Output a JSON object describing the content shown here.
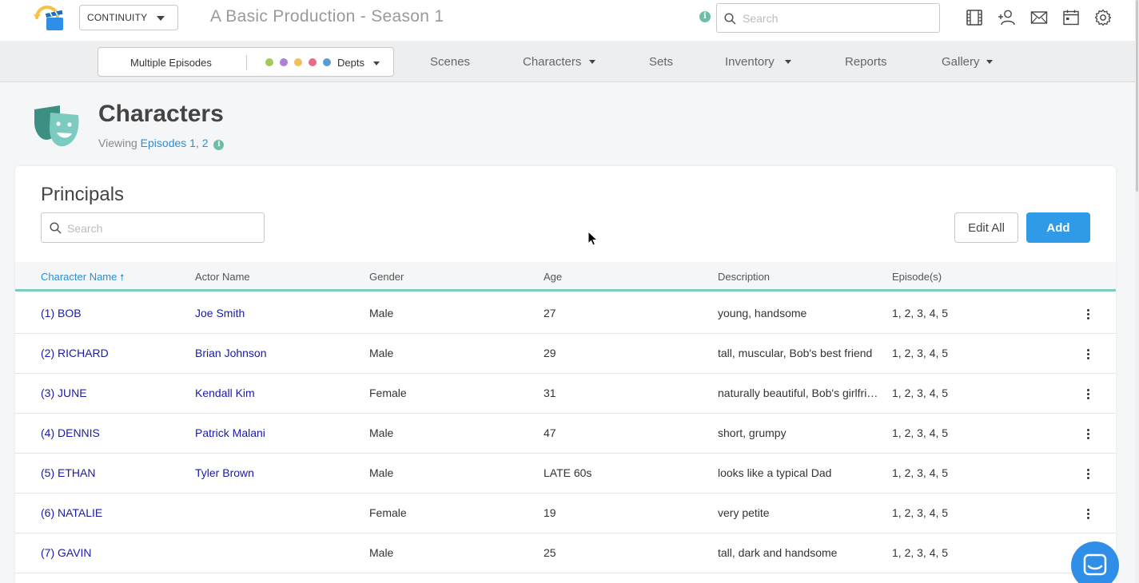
{
  "app": {
    "selector_label": "CONTINUITY",
    "production_title": "A Basic Production - Season 1",
    "search_placeholder": "Search",
    "info_glyph": "i"
  },
  "icons": [
    "film-icon",
    "add-user-icon",
    "mail-icon",
    "calendar-icon",
    "gear-icon"
  ],
  "nav": {
    "episodes_label": "Multiple Episodes",
    "depts_label": "Depts",
    "dept_colors": [
      "#a3c95c",
      "#b07fd6",
      "#f0c05a",
      "#ea6b85",
      "#5b9bd5"
    ],
    "items": [
      {
        "label": "Scenes",
        "has_dropdown": false
      },
      {
        "label": "Characters",
        "has_dropdown": true
      },
      {
        "label": "Sets",
        "has_dropdown": false
      },
      {
        "label": "Inventory",
        "has_dropdown": true
      },
      {
        "label": "Reports",
        "has_dropdown": false
      },
      {
        "label": "Gallery",
        "has_dropdown": true
      }
    ]
  },
  "page": {
    "title": "Characters",
    "viewing_prefix": "Viewing",
    "viewing_link": "Episodes 1, 2"
  },
  "section": {
    "title": "Principals",
    "search_placeholder": "Search",
    "edit_all_label": "Edit All",
    "add_label": "Add"
  },
  "table": {
    "sort_glyph": "🠕",
    "columns": [
      "Character Name",
      "Actor Name",
      "Gender",
      "Age",
      "Description",
      "Episode(s)"
    ],
    "rows": [
      {
        "character": "(1) BOB",
        "actor": "Joe Smith",
        "gender": "Male",
        "age": "27",
        "description": "young, handsome",
        "episodes": "1, 2, 3, 4, 5"
      },
      {
        "character": "(2) RICHARD",
        "actor": "Brian Johnson",
        "gender": "Male",
        "age": "29",
        "description": "tall, muscular, Bob's best friend",
        "episodes": "1, 2, 3, 4, 5"
      },
      {
        "character": "(3) JUNE",
        "actor": "Kendall Kim",
        "gender": "Female",
        "age": "31",
        "description": "naturally beautiful, Bob's girlfriend",
        "episodes": "1, 2, 3, 4, 5"
      },
      {
        "character": "(4) DENNIS",
        "actor": "Patrick Malani",
        "gender": "Male",
        "age": "47",
        "description": "short, grumpy",
        "episodes": "1, 2, 3, 4, 5"
      },
      {
        "character": "(5) ETHAN",
        "actor": "Tyler Brown",
        "gender": "Male",
        "age": "LATE 60s",
        "description": "looks like a typical Dad",
        "episodes": "1, 2, 3, 4, 5"
      },
      {
        "character": "(6) NATALIE",
        "actor": "",
        "gender": "Female",
        "age": "19",
        "description": "very petite",
        "episodes": "1, 2, 3, 4, 5"
      },
      {
        "character": "(7) GAVIN",
        "actor": "",
        "gender": "Male",
        "age": "25",
        "description": "tall, dark and handsome",
        "episodes": "1, 2, 3, 4, 5"
      }
    ]
  }
}
